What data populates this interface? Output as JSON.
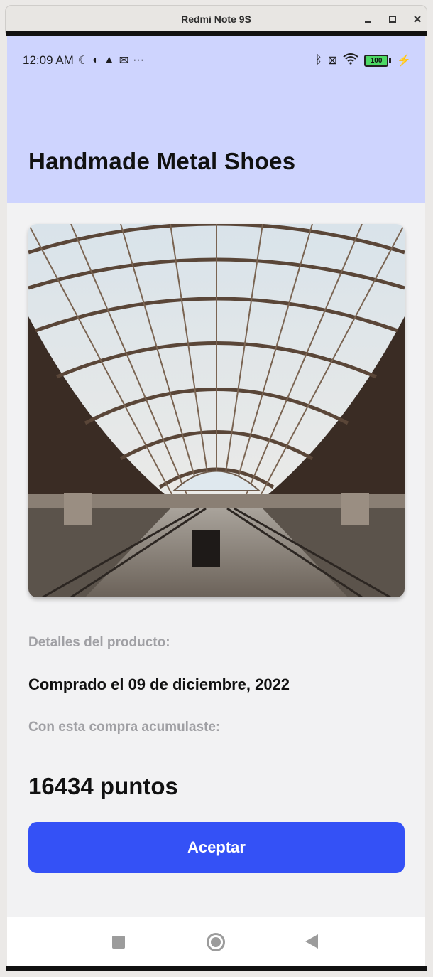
{
  "window": {
    "title": "Redmi Note 9S"
  },
  "status_bar": {
    "time": "12:09 AM",
    "more": "···",
    "battery": "100"
  },
  "header": {
    "title": "Handmade Metal Shoes"
  },
  "product": {
    "image_alt": "train station interior",
    "details_label": "Detalles del producto:",
    "purchase_date": "Comprado el 09 de diciembre, 2022",
    "accumulated_label": "Con esta compra acumulaste:",
    "points": "16434 puntos"
  },
  "actions": {
    "accept_label": "Aceptar"
  },
  "colors": {
    "header_bg": "#ced4fe",
    "accent": "#3451f6",
    "page_bg": "#f2f2f3",
    "muted_text": "#a0a0a4"
  }
}
